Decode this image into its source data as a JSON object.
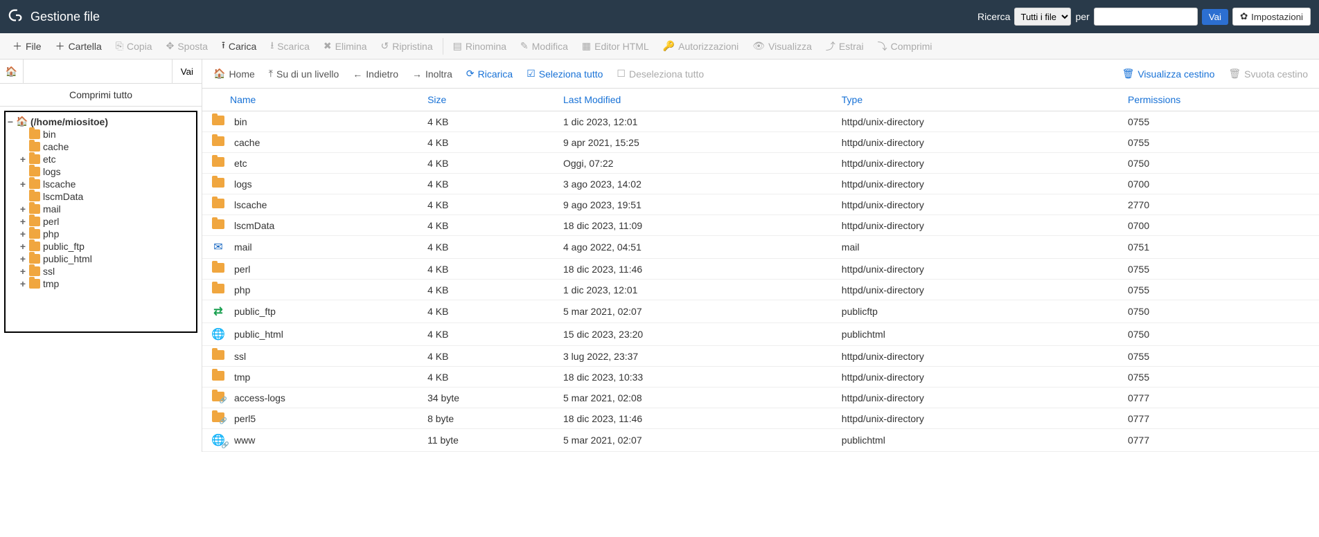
{
  "header": {
    "title": "Gestione file",
    "search_label": "Ricerca",
    "search_scope": "Tutti i file",
    "per_label": "per",
    "go": "Vai",
    "settings": "Impostazioni"
  },
  "toolbar": {
    "file": "File",
    "folder": "Cartella",
    "copy": "Copia",
    "move": "Sposta",
    "upload": "Carica",
    "download": "Scarica",
    "delete": "Elimina",
    "restore": "Ripristina",
    "rename": "Rinomina",
    "edit": "Modifica",
    "html_editor": "Editor HTML",
    "permissions": "Autorizzazioni",
    "view": "Visualizza",
    "extract": "Estrai",
    "compress": "Comprimi"
  },
  "sidebar": {
    "go": "Vai",
    "collapse_all": "Comprimi tutto",
    "path_value": "",
    "root": "(/home/miositoe)",
    "nodes": [
      {
        "label": "bin",
        "expandable": false
      },
      {
        "label": "cache",
        "expandable": false
      },
      {
        "label": "etc",
        "expandable": true
      },
      {
        "label": "logs",
        "expandable": false
      },
      {
        "label": "lscache",
        "expandable": true
      },
      {
        "label": "lscmData",
        "expandable": false
      },
      {
        "label": "mail",
        "expandable": true
      },
      {
        "label": "perl",
        "expandable": true
      },
      {
        "label": "php",
        "expandable": true
      },
      {
        "label": "public_ftp",
        "expandable": true
      },
      {
        "label": "public_html",
        "expandable": true
      },
      {
        "label": "ssl",
        "expandable": true
      },
      {
        "label": "tmp",
        "expandable": true
      }
    ]
  },
  "navbar": {
    "home": "Home",
    "up": "Su di un livello",
    "back": "Indietro",
    "forward": "Inoltra",
    "reload": "Ricarica",
    "select_all": "Seleziona tutto",
    "deselect_all": "Deseleziona tutto",
    "view_trash": "Visualizza cestino",
    "empty_trash": "Svuota cestino"
  },
  "table": {
    "columns": {
      "name": "Name",
      "size": "Size",
      "modified": "Last Modified",
      "type": "Type",
      "perms": "Permissions"
    },
    "rows": [
      {
        "icon": "folder",
        "name": "bin",
        "size": "4 KB",
        "modified": "1 dic 2023, 12:01",
        "type": "httpd/unix-directory",
        "perms": "0755"
      },
      {
        "icon": "folder",
        "name": "cache",
        "size": "4 KB",
        "modified": "9 apr 2021, 15:25",
        "type": "httpd/unix-directory",
        "perms": "0755"
      },
      {
        "icon": "folder",
        "name": "etc",
        "size": "4 KB",
        "modified": "Oggi, 07:22",
        "type": "httpd/unix-directory",
        "perms": "0750"
      },
      {
        "icon": "folder",
        "name": "logs",
        "size": "4 KB",
        "modified": "3 ago 2023, 14:02",
        "type": "httpd/unix-directory",
        "perms": "0700"
      },
      {
        "icon": "folder",
        "name": "lscache",
        "size": "4 KB",
        "modified": "9 ago 2023, 19:51",
        "type": "httpd/unix-directory",
        "perms": "2770"
      },
      {
        "icon": "folder",
        "name": "lscmData",
        "size": "4 KB",
        "modified": "18 dic 2023, 11:09",
        "type": "httpd/unix-directory",
        "perms": "0700"
      },
      {
        "icon": "mail",
        "name": "mail",
        "size": "4 KB",
        "modified": "4 ago 2022, 04:51",
        "type": "mail",
        "perms": "0751"
      },
      {
        "icon": "folder",
        "name": "perl",
        "size": "4 KB",
        "modified": "18 dic 2023, 11:46",
        "type": "httpd/unix-directory",
        "perms": "0755"
      },
      {
        "icon": "folder",
        "name": "php",
        "size": "4 KB",
        "modified": "1 dic 2023, 12:01",
        "type": "httpd/unix-directory",
        "perms": "0755"
      },
      {
        "icon": "swap",
        "name": "public_ftp",
        "size": "4 KB",
        "modified": "5 mar 2021, 02:07",
        "type": "publicftp",
        "perms": "0750"
      },
      {
        "icon": "globe",
        "name": "public_html",
        "size": "4 KB",
        "modified": "15 dic 2023, 23:20",
        "type": "publichtml",
        "perms": "0750"
      },
      {
        "icon": "folder",
        "name": "ssl",
        "size": "4 KB",
        "modified": "3 lug 2022, 23:37",
        "type": "httpd/unix-directory",
        "perms": "0755"
      },
      {
        "icon": "folder",
        "name": "tmp",
        "size": "4 KB",
        "modified": "18 dic 2023, 10:33",
        "type": "httpd/unix-directory",
        "perms": "0755"
      },
      {
        "icon": "folder-link",
        "name": "access-logs",
        "size": "34 byte",
        "modified": "5 mar 2021, 02:08",
        "type": "httpd/unix-directory",
        "perms": "0777"
      },
      {
        "icon": "folder-link",
        "name": "perl5",
        "size": "8 byte",
        "modified": "18 dic 2023, 11:46",
        "type": "httpd/unix-directory",
        "perms": "0777"
      },
      {
        "icon": "globe-link",
        "name": "www",
        "size": "11 byte",
        "modified": "5 mar 2021, 02:07",
        "type": "publichtml",
        "perms": "0777"
      }
    ]
  }
}
